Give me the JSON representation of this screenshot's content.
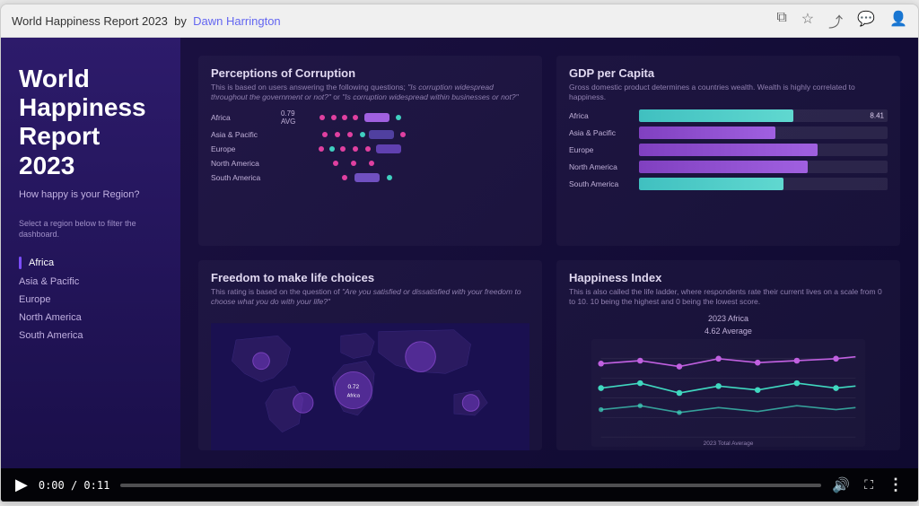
{
  "browser": {
    "title": "World Happiness Report 2023",
    "author": "Dawn Harrington"
  },
  "sidebar": {
    "title": "World Happiness Report 2023",
    "subtitle": "How happy is your Region?",
    "instruction": "Select a region below to filter the dashboard.",
    "regions": [
      {
        "label": "Africa",
        "active": true
      },
      {
        "label": "Asia & Pacific",
        "active": false
      },
      {
        "label": "Europe",
        "active": false
      },
      {
        "label": "North America",
        "active": false
      },
      {
        "label": "South America",
        "active": false
      }
    ]
  },
  "charts": {
    "corruption": {
      "title": "Perceptions of Corruption",
      "subtitle": "This is based on users answering the following questions; \"Is corruption widespread throughout the government or not?\" or \"Is corruption widespread within businesses or not?\"",
      "avg_label": "AVG",
      "africa_avg": "0.79"
    },
    "gdp": {
      "title": "GDP per Capita",
      "subtitle": "Gross domestic product determines a countries wealth. Wealth is highly correlated to happiness.",
      "bars": [
        {
          "region": "Africa",
          "value": 8.41,
          "pct": 62,
          "type": "teal"
        },
        {
          "region": "Asia & Pacific",
          "value": 8.2,
          "pct": 60,
          "type": "purple"
        },
        {
          "region": "Europe",
          "value": 9.85,
          "pct": 72,
          "type": "purple"
        },
        {
          "region": "North America",
          "value": 9.6,
          "pct": 70,
          "type": "purple"
        },
        {
          "region": "South America",
          "value": 8.1,
          "pct": 59,
          "type": "teal"
        }
      ]
    },
    "freedom": {
      "title": "Freedom to make life choices",
      "subtitle": "This rating is based on the question of \"Are you satisfied or dissatisfied with your freedom to choose what you do with your life?\""
    },
    "happiness": {
      "title": "Happiness Index",
      "subtitle": "This is also called the life ladder, where respondents rate their current lives on a scale from 0 to 10. 10 being the highest and 0 being the lowest score.",
      "chart_label_top": "2023 Africa",
      "chart_label_avg": "4.62 Average",
      "chart_label_bottom": "2023 Total Average"
    }
  },
  "controls": {
    "play_icon": "▶",
    "time": "0:00 / 0:11",
    "volume_icon": "🔊",
    "fullscreen_icon": "⛶",
    "more_icon": "⋮",
    "progress_pct": 0
  }
}
